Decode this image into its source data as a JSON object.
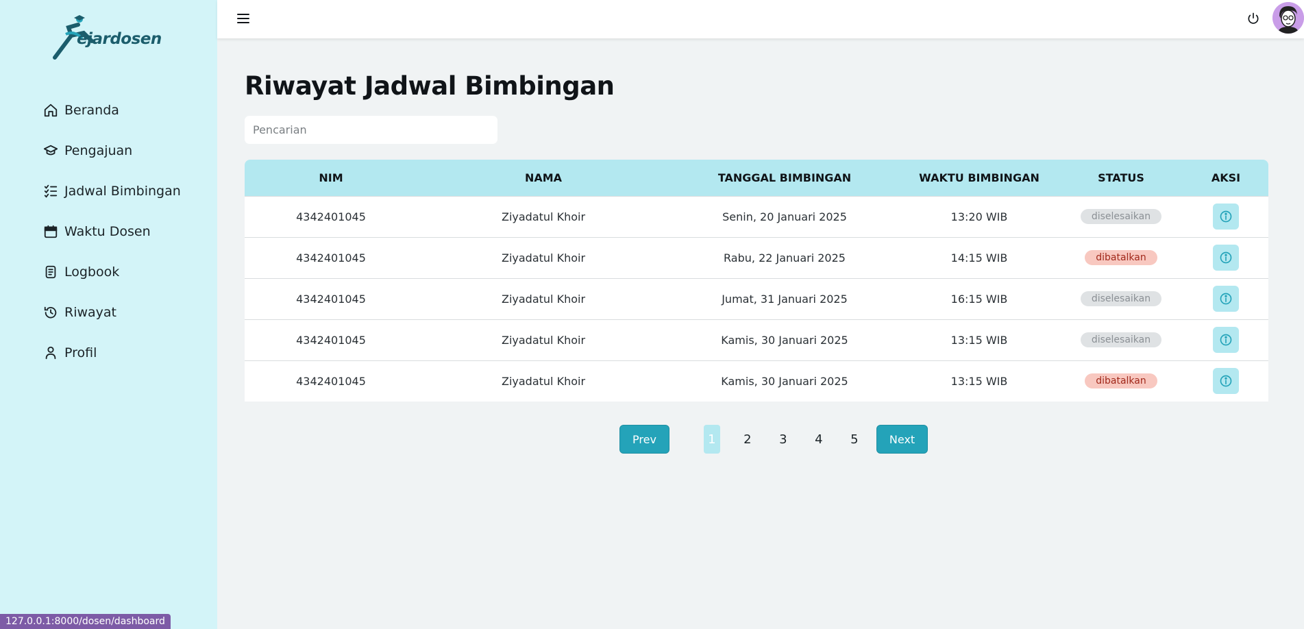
{
  "app": {
    "logo_text": "ejardosen"
  },
  "sidebar": {
    "items": [
      {
        "label": "Beranda",
        "icon": "home-icon"
      },
      {
        "label": "Pengajuan",
        "icon": "graduation-cap-icon"
      },
      {
        "label": "Jadwal Bimbingan",
        "icon": "checklist-icon"
      },
      {
        "label": "Waktu Dosen",
        "icon": "calendar-icon"
      },
      {
        "label": "Logbook",
        "icon": "clipboard-icon"
      },
      {
        "label": "Riwayat",
        "icon": "history-icon"
      },
      {
        "label": "Profil",
        "icon": "user-icon"
      }
    ]
  },
  "topbar": {
    "menu_icon": "hamburger-icon",
    "power_icon": "power-icon",
    "avatar_icon": "avatar"
  },
  "main": {
    "title": "Riwayat Jadwal Bimbingan",
    "search_placeholder": "Pencarian"
  },
  "table": {
    "headers": [
      "NIM",
      "NAMA",
      "TANGGAL BIMBINGAN",
      "WAKTU BIMBINGAN",
      "STATUS",
      "AKSI"
    ],
    "rows": [
      {
        "nim": "4342401045",
        "nama": "Ziyadatul Khoir",
        "tanggal": "Senin, 20 Januari 2025",
        "waktu": "13:20 WIB",
        "status": "diselesaikan"
      },
      {
        "nim": "4342401045",
        "nama": "Ziyadatul Khoir",
        "tanggal": "Rabu, 22 Januari 2025",
        "waktu": "14:15 WIB",
        "status": "dibatalkan"
      },
      {
        "nim": "4342401045",
        "nama": "Ziyadatul Khoir",
        "tanggal": "Jumat, 31 Januari 2025",
        "waktu": "16:15 WIB",
        "status": "diselesaikan"
      },
      {
        "nim": "4342401045",
        "nama": "Ziyadatul Khoir",
        "tanggal": "Kamis, 30 Januari 2025",
        "waktu": "13:15 WIB",
        "status": "diselesaikan"
      },
      {
        "nim": "4342401045",
        "nama": "Ziyadatul Khoir",
        "tanggal": "Kamis, 30 Januari 2025",
        "waktu": "13:15 WIB",
        "status": "dibatalkan"
      }
    ]
  },
  "pagination": {
    "prev_label": "Prev",
    "next_label": "Next",
    "pages": [
      "1",
      "2",
      "3",
      "4",
      "5"
    ],
    "current": "1"
  },
  "statusbar": {
    "url": "127.0.0.1:8000/dosen/dashboard"
  },
  "colors": {
    "sidebar_bg": "#d3f4f8",
    "header_bg": "#b3e8f0",
    "accent": "#24a3b9",
    "done_badge": "#dfe2e4",
    "cancel_badge": "#f8c8c0"
  }
}
